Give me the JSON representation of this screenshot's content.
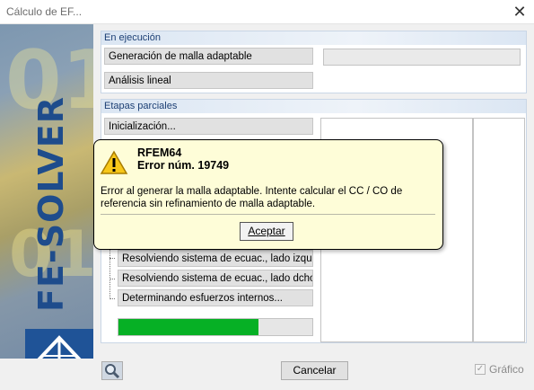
{
  "window": {
    "title": "Cálculo de EF...",
    "close_glyph": "✕"
  },
  "banner": {
    "vertical_text": "FE-SOLVER",
    "ghost_text": "01"
  },
  "sections": {
    "running": {
      "title": "En ejecución",
      "items": [
        {
          "label": "Generación de malla adaptable"
        },
        {
          "label": "Análisis lineal"
        }
      ]
    },
    "partial": {
      "title": "Etapas parciales",
      "items": [
        {
          "label": "Inicialización..."
        },
        {
          "label": "Resolviendo sistema de ecuac., lado izqu..."
        },
        {
          "label": "Resolviendo sistema de ecuac., lado dcho..."
        },
        {
          "label": "Determinando esfuerzos internos..."
        }
      ],
      "progress": 0.72
    }
  },
  "dialog": {
    "app": "RFEM64",
    "error_code": "Error núm. 19749",
    "message": "Error al generar la malla adaptable. Intente calcular el CC / CO de referencia sin refinamiento de malla adaptable.",
    "ok_label": "Aceptar",
    "icon": "warning-icon"
  },
  "footer": {
    "cancel_label": "Cancelar",
    "graphic_label": "Gráfico",
    "graphic_checked": true,
    "magnifier_icon": "magnifier-icon"
  },
  "colors": {
    "accent": "#1f5397",
    "progress": "#06b025",
    "dialog_bg": "#fefdd8",
    "section_title": "#1c3f74"
  }
}
